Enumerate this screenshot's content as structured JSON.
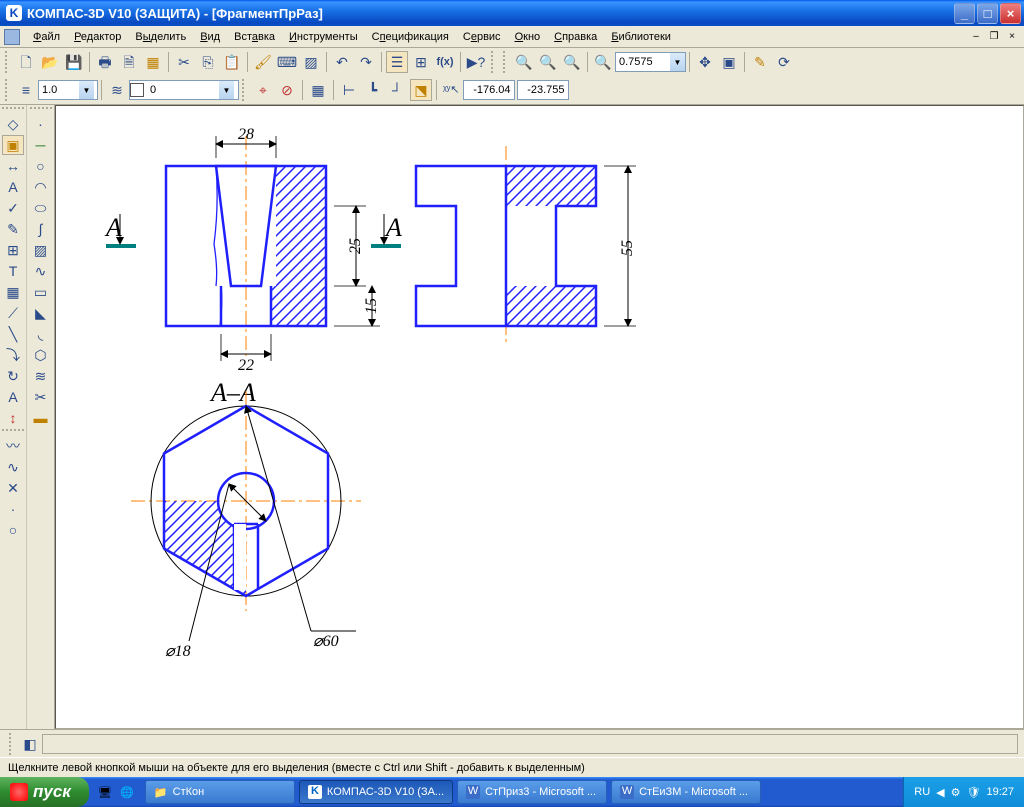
{
  "titlebar": {
    "app": "КОМПАС-3D V10 (ЗАЩИТА)",
    "doc": "[ФрагментПрРаз]"
  },
  "menu": [
    "Файл",
    "Редактор",
    "Выделить",
    "Вид",
    "Вставка",
    "Инструменты",
    "Спецификация",
    "Сервис",
    "Окно",
    "Справка",
    "Библиотеки"
  ],
  "toolbar1": {
    "zoom": "0.7575"
  },
  "toolbar2": {
    "line_w": "1.0",
    "layer": "0",
    "coord_x": "-176.04",
    "coord_y": "-23.755"
  },
  "drawing": {
    "section_label": "А–А",
    "cut_A_left": "А",
    "cut_A_right": "А",
    "dims": {
      "d28": "28",
      "d22": "22",
      "d25": "25",
      "d15": "15",
      "d55": "55",
      "dia18": "⌀18",
      "dia60": "⌀60"
    }
  },
  "status": "Щелкните левой кнопкой мыши на объекте для его выделения (вместе с Ctrl или Shift - добавить к выделенным)",
  "taskbar": {
    "start": "пуск",
    "tasks": [
      {
        "label": "СтКон",
        "icon": "📁"
      },
      {
        "label": "КОМПАС-3D V10 (ЗА...",
        "icon": "K",
        "active": true
      },
      {
        "label": "СтПриз3 - Microsoft ...",
        "icon": "W"
      },
      {
        "label": "СтЕиЗМ - Microsoft ...",
        "icon": "W"
      }
    ],
    "lang": "RU",
    "clock": "19:27"
  }
}
